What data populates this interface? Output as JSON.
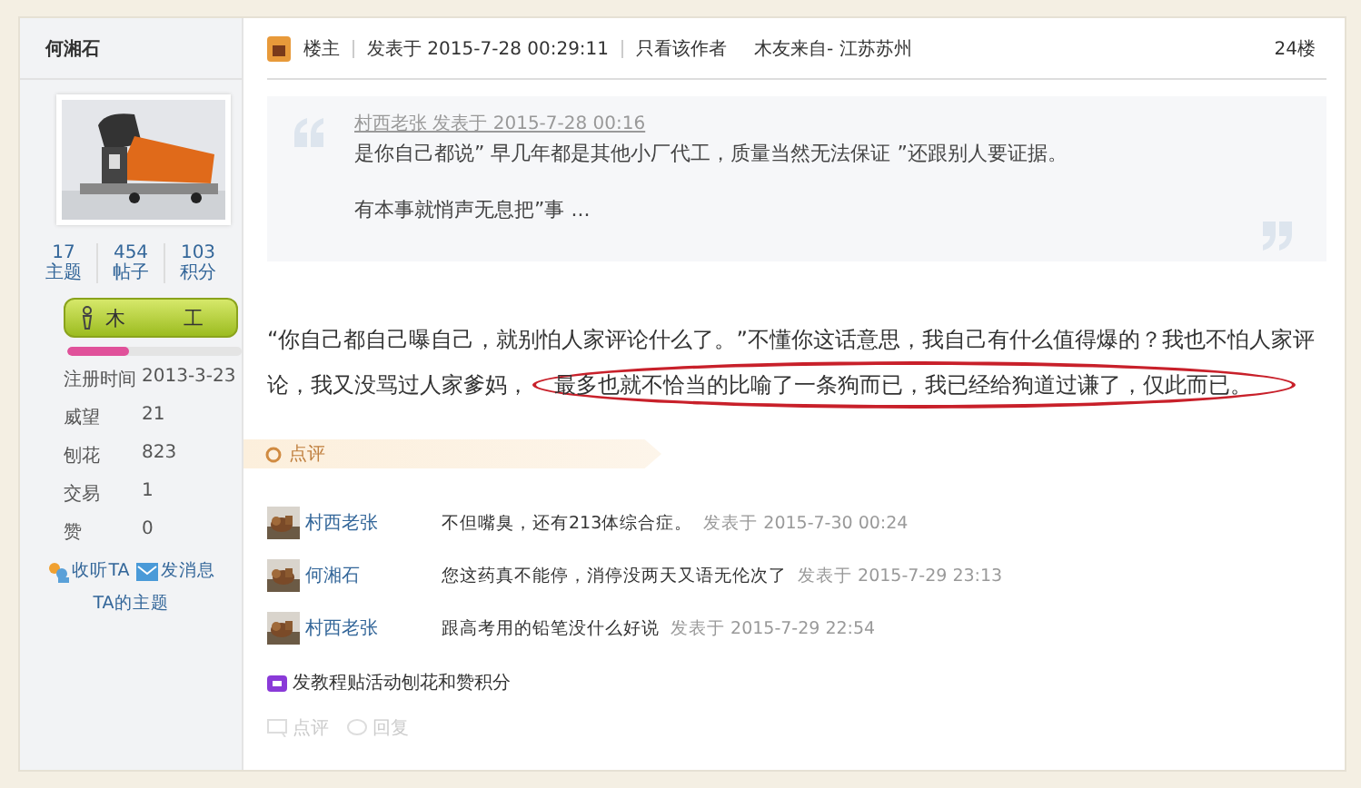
{
  "sidebar": {
    "username": "何湘石",
    "stats": [
      {
        "value": "17",
        "label": "主题"
      },
      {
        "value": "454",
        "label": "帖子"
      },
      {
        "value": "103",
        "label": "积分"
      }
    ],
    "rank": {
      "parts": [
        "木",
        "工"
      ],
      "level": 0.35
    },
    "info": [
      {
        "label": "注册时间",
        "value": "2013-3-23"
      },
      {
        "label": "威望",
        "value": "21"
      },
      {
        "label": "刨花",
        "value": "823"
      },
      {
        "label": "交易",
        "value": "1"
      },
      {
        "label": "赞",
        "value": "0"
      }
    ],
    "actions": [
      {
        "kind": "follow",
        "label": "收听TA"
      },
      {
        "kind": "message",
        "label": "发消息"
      },
      {
        "kind": "topics",
        "label": "TA的主题"
      }
    ]
  },
  "post": {
    "header": {
      "role": "楼主",
      "posted": "发表于 2015-7-28 00:29:11",
      "author_only": "只看该作者",
      "origin": "木友来自- 江苏苏州",
      "floor": "24楼"
    },
    "quote": {
      "meta": "村西老张 发表于 2015-7-28 00:16",
      "lines": [
        "是你自己都说” 早几年都是其他小厂代工，质量当然无法保证 ”还跟别人要证据。",
        "有本事就悄声无息把”事 ..."
      ]
    },
    "body": [
      {
        "text": "“你自己都自己曝自己，就别怕人家评论什么了。”不懂你这话意思，我自己有什么值得爆的？我也不怕人家评",
        "circled": false
      },
      {
        "text": "论，我又没骂过人家爹妈，",
        "circled": false
      },
      {
        "text": "最多也就不恰当的比喻了一条狗而已，我已经给狗道过谦了，仅此而已。",
        "circled": true
      }
    ],
    "rating": {
      "label": "点评"
    },
    "comments": [
      {
        "user": "村西老张",
        "text": "不但嘴臭，还有213体综合症。",
        "time": "发表于 2015-7-30 00:24"
      },
      {
        "user": "何湘石",
        "text": "您这药真不能停，消停没两天又语无伦次了",
        "time": "发表于 2015-7-29 23:13"
      },
      {
        "user": "村西老张",
        "text": "跟高考用的铅笔没什么好说",
        "time": "发表于 2015-7-29 22:54"
      }
    ],
    "promo": "发教程贴活动刨花和赞积分",
    "footer": [
      {
        "kind": "rate",
        "label": "点评"
      },
      {
        "kind": "reply",
        "label": "回复"
      }
    ]
  }
}
